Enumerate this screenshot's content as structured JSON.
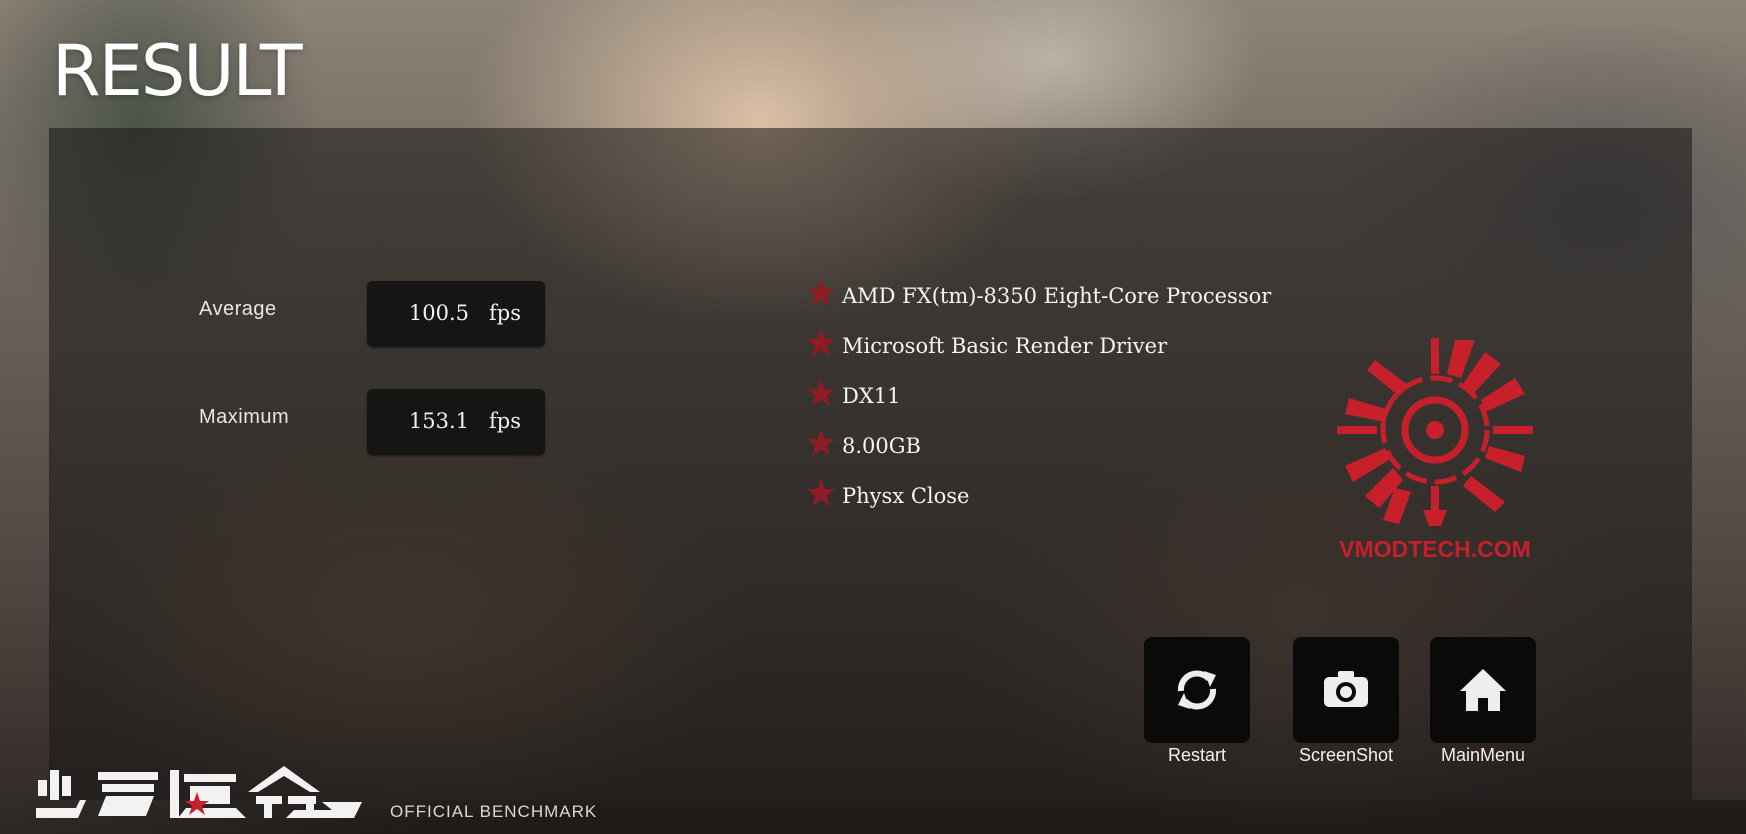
{
  "header": {
    "title": "RESULT"
  },
  "stats": [
    {
      "label": "Average",
      "value": "100.5",
      "unit": "fps"
    },
    {
      "label": "Maximum",
      "value": "153.1",
      "unit": "fps"
    }
  ],
  "specs": [
    "AMD FX(tm)-8350 Eight-Core Processor",
    "Microsoft Basic Render Driver",
    "DX11",
    "8.00GB",
    "Physx Close"
  ],
  "watermark": {
    "text": "VMODTECH.COM",
    "color": "#c8202a"
  },
  "buttons": [
    {
      "label": "Restart",
      "icon": "restart-icon"
    },
    {
      "label": "ScreenShot",
      "icon": "camera-icon"
    },
    {
      "label": "MainMenu",
      "icon": "home-icon"
    }
  ],
  "footer": {
    "tagline": "OFFICIAL BENCHMARK"
  },
  "colors": {
    "star": "#8e1c22",
    "panel": "#181615",
    "button": "#080808"
  }
}
